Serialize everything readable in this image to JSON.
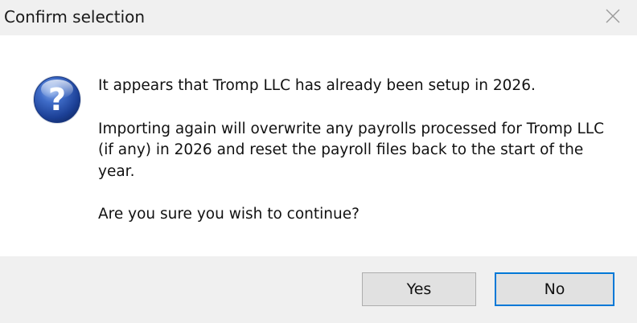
{
  "window": {
    "title": "Confirm selection",
    "close_icon": "close-icon"
  },
  "message": {
    "icon": "question-icon",
    "line1": "It appears that Tromp LLC has already been setup in 2026.",
    "paragraph2": "Importing again will overwrite any payrolls processed for Tromp LLC (if any) in 2026 and reset the payroll files back to the start of the year.",
    "line3": "Are you sure you wish to continue?"
  },
  "buttons": {
    "yes_label": "Yes",
    "no_label": "No"
  },
  "colors": {
    "focus_border": "#0078d7",
    "icon_blue": "#1f4fa8"
  }
}
